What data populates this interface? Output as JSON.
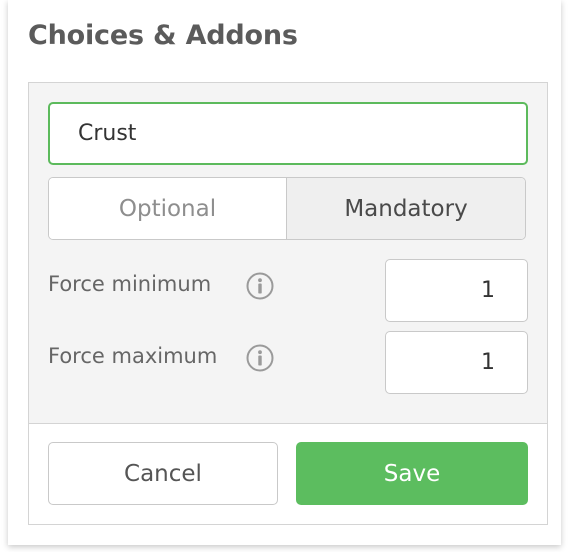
{
  "title": "Choices & Addons",
  "group_name": {
    "value": "Crust"
  },
  "selection_toggle": {
    "optional_label": "Optional",
    "mandatory_label": "Mandatory",
    "selected": "Mandatory"
  },
  "force_minimum": {
    "label": "Force minimum",
    "value": "1",
    "info_icon": "info-icon"
  },
  "force_maximum": {
    "label": "Force maximum",
    "value": "1",
    "info_icon": "info-icon"
  },
  "actions": {
    "cancel_label": "Cancel",
    "save_label": "Save"
  },
  "colors": {
    "accent": "#5cbd5f",
    "focus_border": "#5cba5c",
    "title": "#5b5b5b"
  }
}
